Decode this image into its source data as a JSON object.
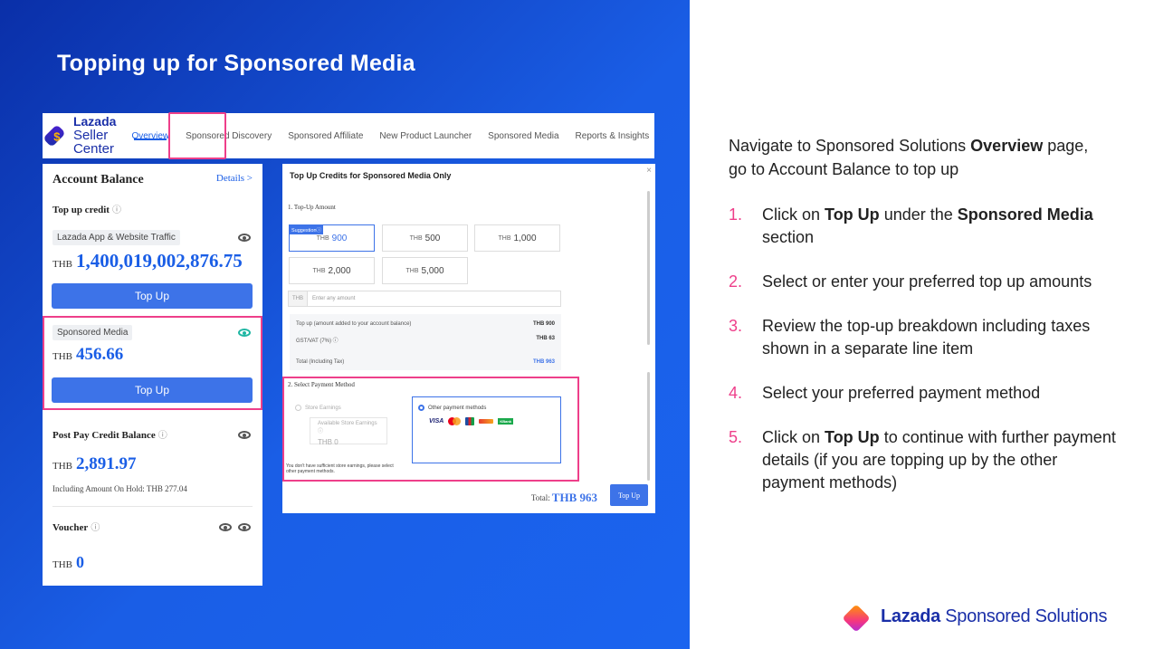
{
  "slide_title": "Topping up for Sponsored Media",
  "header": {
    "logo_line1": "Lazada",
    "logo_line2": "Seller Center",
    "tabs": [
      {
        "label": "Overview",
        "active": true
      },
      {
        "label": "Sponsored Discovery"
      },
      {
        "label": "Sponsored Affiliate"
      },
      {
        "label": "New Product Launcher"
      },
      {
        "label": "Sponsored Media"
      },
      {
        "label": "Reports & Insights"
      }
    ]
  },
  "account": {
    "title": "Account Balance",
    "details_link": "Details >",
    "topup_credit_label": "Top up credit",
    "traffic_pill": "Lazada App & Website Traffic",
    "currency": "THB",
    "traffic_amount": "1,400,019,002,876.75",
    "topup_button": "Top Up",
    "sm_pill": "Sponsored Media",
    "sm_amount": "456.66",
    "sm_topup_button": "Top Up",
    "postpay_label": "Post Pay Credit Balance",
    "postpay_amount": "2,891.97",
    "on_hold_note": "Including Amount On Hold: THB 277.04",
    "voucher_label": "Voucher",
    "voucher_amount": "0",
    "info_glyph": "ⓘ"
  },
  "modal": {
    "title": "Top Up Credits for Sponsored Media Only",
    "close": "×",
    "section1": "1. Top-Up Amount",
    "suggestion_badge": "Suggestionⓘ",
    "amount_prefix": "THB",
    "amounts": [
      "900",
      "500",
      "1,000",
      "2,000",
      "5,000"
    ],
    "enter_prefix": "THB",
    "enter_placeholder": "Enter any amount",
    "breakdown": [
      {
        "label": "Top up (amount added to your account balance)",
        "value": "THB 900"
      },
      {
        "label": "GST/VAT (7%) ⓘ",
        "value": "THB 63"
      },
      {
        "label": "Total (Including Tax)",
        "value": "THB 963"
      }
    ],
    "section2": "2. Select Payment Method",
    "store_earnings": "Store Earnings",
    "available_store_earnings": "Available Store Earnings ⓘ",
    "store_earnings_amount": "THB  0",
    "other_methods": "Other payment methods",
    "visa_label": "VISA",
    "kbank_label": "KBank",
    "insufficient_note": "You don't have sufficient store earnings, please select other payment methods.",
    "total_label": "Total:",
    "total_value": "THB 963",
    "topup_button": "Top Up"
  },
  "instructions": {
    "intro_pre": "Navigate to Sponsored Solutions ",
    "intro_bold": "Overview",
    "intro_post": " page, go to Account Balance to top up",
    "steps": [
      {
        "num": "1.",
        "pre": "Click on ",
        "b1": "Top Up",
        "mid": " under the ",
        "b2": "Sponsored Media",
        "post": " section"
      },
      {
        "num": "2.",
        "text": "Select or enter your preferred top up amounts"
      },
      {
        "num": "3.",
        "text": "Review the top-up breakdown including taxes shown in a separate line item"
      },
      {
        "num": "4.",
        "text": "Select your preferred payment method"
      },
      {
        "num": "5.",
        "pre": "Click on ",
        "b1": "Top Up",
        "post": " to continue with further payment details (if you are topping up by the other payment methods)"
      }
    ]
  },
  "brand": {
    "bold": "Lazada",
    "light": " Sponsored Solutions"
  },
  "colors": {
    "accent_pink": "#ee3f8a",
    "blue": "#1a5ee6",
    "button_blue": "#3d73e8"
  }
}
